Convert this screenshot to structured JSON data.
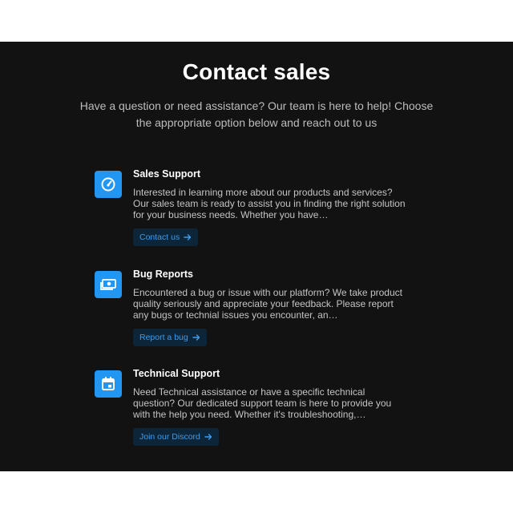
{
  "heading": {
    "title": "Contact sales",
    "subtitle": "Have a question or need assistance? Our team is here to help! Choose the appropriate option below and reach out to us"
  },
  "cards": [
    {
      "icon": "speedometer-icon",
      "title": "Sales Support",
      "description": "Interested in learning more about our products and services? Our sales team is ready to assist you in finding the right solution for your business needs. Whether you have…",
      "button_label": "Contact us"
    },
    {
      "icon": "money-icon",
      "title": "Bug Reports",
      "description": "Encountered a bug or issue with our platform? We take product quality seriously and appreciate your feedback. Please report any bugs or technial issues you encounter, an…",
      "button_label": "Report a bug"
    },
    {
      "icon": "calendar-icon",
      "title": "Technical Support",
      "description": "Need Technical assistance or have a specific technical question? Our dedicated support team is here to provide you with the help you need. Whether it's troubleshooting,…",
      "button_label": "Join our Discord"
    }
  ],
  "colors": {
    "background": "#121212",
    "accent": "#2196f3",
    "button_bg": "#0d2538",
    "button_text": "#3d9be9"
  }
}
